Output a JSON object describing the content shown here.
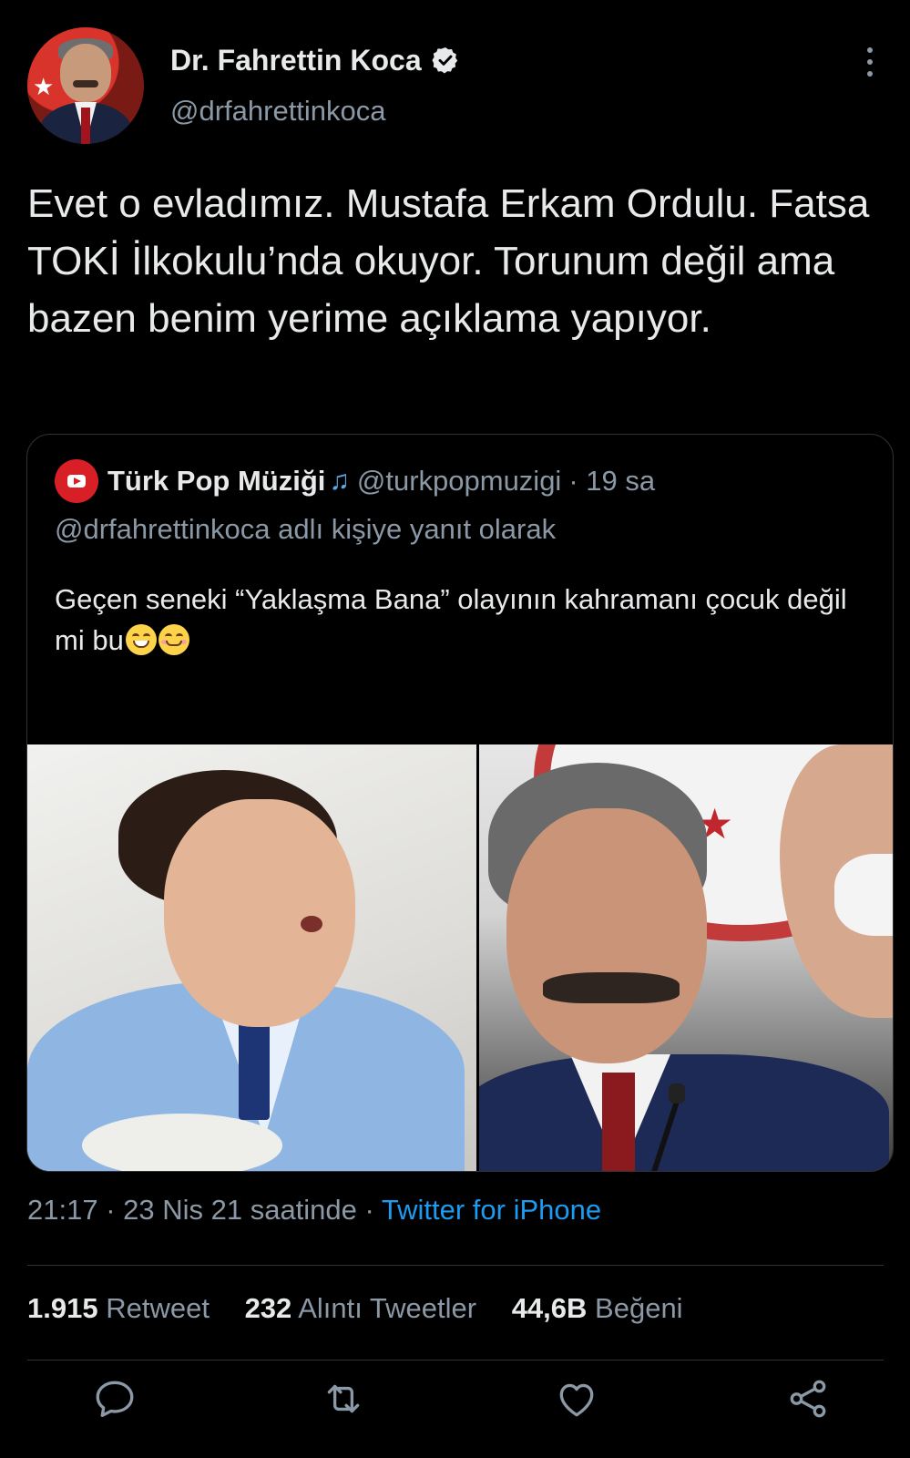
{
  "header": {
    "name": "Dr. Fahrettin Koca",
    "handle": "@drfahrettinkoca"
  },
  "tweet": {
    "text": "Evet o evladımız. Mustafa Erkam Ordulu. Fatsa TOKİ İlkokulu’nda okuyor. Torunum değil ama bazen benim yerime açıklama yapıyor."
  },
  "quote": {
    "name": "Türk Pop Müziği",
    "handle": "@turkpopmuzigi",
    "time": "· 19 sa",
    "reply": "@drfahrettinkoca adlı kişiye yanıt olarak",
    "text": "Geçen seneki “Yaklaşma Bana” olayının kahramanı çocuk değil mi bu"
  },
  "meta": {
    "time": "21:17 · 23 Nis 21 saatinde ·",
    "source": "Twitter for iPhone"
  },
  "stats": {
    "retweets": "1.915",
    "retweets_label": "Retweet",
    "quotes": "232",
    "quotes_label": "Alıntı Tweetler",
    "likes": "44,6B",
    "likes_label": "Beğeni"
  },
  "actions": [
    "reply-icon",
    "retweet-icon",
    "like-icon",
    "share-icon"
  ],
  "colors": {
    "background": "#000000",
    "text": "#e7e9ea",
    "muted": "#8b98a5",
    "link": "#1d9bf0",
    "border": "#2f3336"
  }
}
